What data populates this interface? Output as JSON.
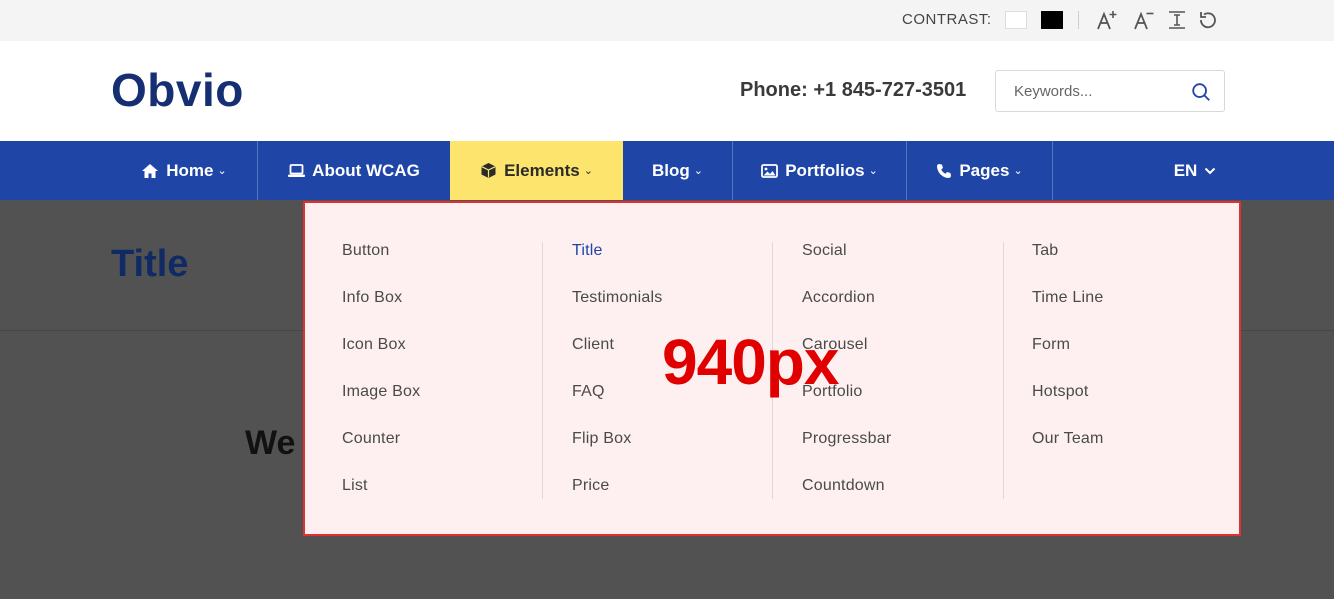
{
  "topbar": {
    "contrast_label": "CONTRAST:",
    "icons": [
      "text-increase-icon",
      "text-decrease-icon",
      "line-height-icon",
      "reset-icon"
    ]
  },
  "header": {
    "logo": "Obvio",
    "phone": "Phone: +1 845-727-3501",
    "search_placeholder": "Keywords..."
  },
  "nav": {
    "items": [
      {
        "label": "Home",
        "icon": "home-icon",
        "has_caret": true
      },
      {
        "label": "About WCAG",
        "icon": "laptop-icon",
        "has_caret": false
      },
      {
        "label": "Elements",
        "icon": "cube-icon",
        "has_caret": true,
        "active": true
      },
      {
        "label": "Blog",
        "icon": "",
        "has_caret": true
      },
      {
        "label": "Portfolios",
        "icon": "image-icon",
        "has_caret": true
      },
      {
        "label": "Pages",
        "icon": "phone-icon",
        "has_caret": true
      }
    ],
    "language": "EN"
  },
  "page": {
    "title": "Title",
    "body_text": "We"
  },
  "mega_menu": {
    "columns": [
      [
        "Button",
        "Info Box",
        "Icon Box",
        "Image Box",
        "Counter",
        "List"
      ],
      [
        "Title",
        "Testimonials",
        "Client",
        "FAQ",
        "Flip Box",
        "Price"
      ],
      [
        "Social",
        "Accordion",
        "Carousel",
        "Portfolio",
        "Progressbar",
        "Countdown"
      ],
      [
        "Tab",
        "Time Line",
        "Form",
        "Hotspot",
        "Our Team"
      ]
    ],
    "current_item": "Title",
    "width_annotation": "940px"
  },
  "colors": {
    "brand_blue": "#1f46a6",
    "logo_navy": "#152f72",
    "active_yellow": "#fde46c",
    "annotation_red": "#e00000",
    "menu_bg": "#fef0f0"
  }
}
